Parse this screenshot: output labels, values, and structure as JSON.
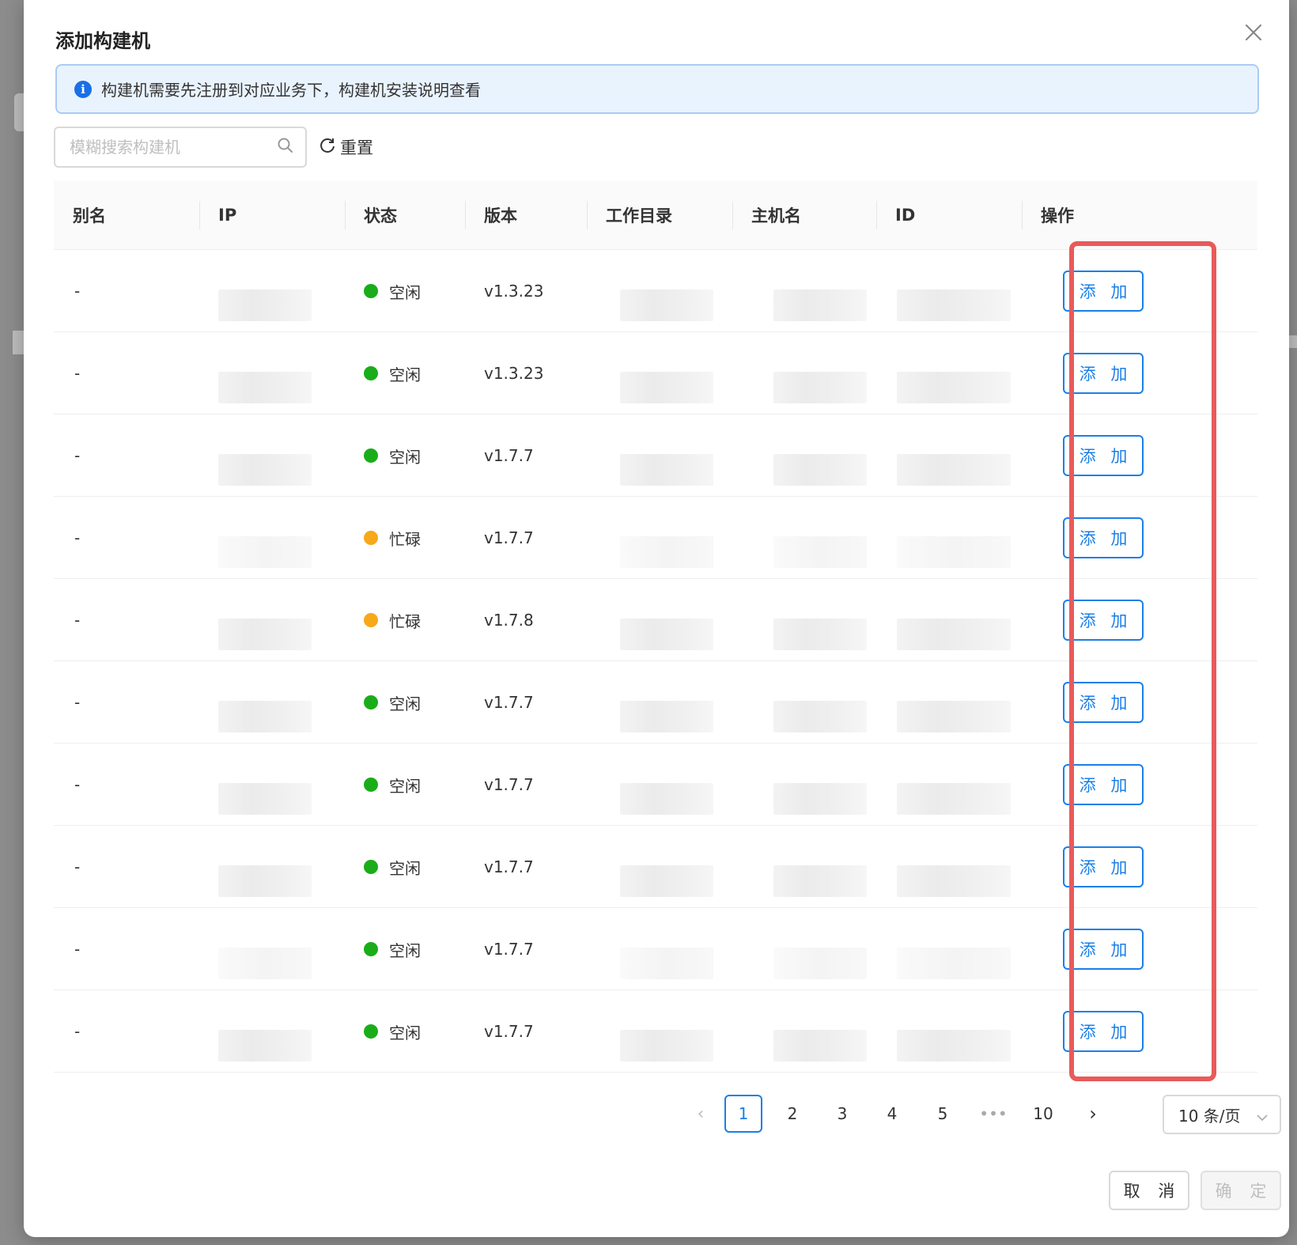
{
  "dialog": {
    "title": "添加构建机",
    "info": "构建机需要先注册到对应业务下，构建机安装说明查看"
  },
  "search": {
    "placeholder": "模糊搜索构建机",
    "reset_label": "重置"
  },
  "table": {
    "columns": [
      "别名",
      "IP",
      "状态",
      "版本",
      "工作目录",
      "主机名",
      "ID",
      "操作"
    ],
    "rows": [
      {
        "alias": "-",
        "status": "空闲",
        "status_color": "#1aad19",
        "version": "v1.3.23",
        "action": "添 加"
      },
      {
        "alias": "-",
        "status": "空闲",
        "status_color": "#1aad19",
        "version": "v1.3.23",
        "action": "添 加"
      },
      {
        "alias": "-",
        "status": "空闲",
        "status_color": "#1aad19",
        "version": "v1.7.7",
        "action": "添 加"
      },
      {
        "alias": "-",
        "status": "忙碌",
        "status_color": "#f7a81b",
        "version": "v1.7.7",
        "action": "添 加"
      },
      {
        "alias": "-",
        "status": "忙碌",
        "status_color": "#f7a81b",
        "version": "v1.7.8",
        "action": "添 加"
      },
      {
        "alias": "-",
        "status": "空闲",
        "status_color": "#1aad19",
        "version": "v1.7.7",
        "action": "添 加"
      },
      {
        "alias": "-",
        "status": "空闲",
        "status_color": "#1aad19",
        "version": "v1.7.7",
        "action": "添 加"
      },
      {
        "alias": "-",
        "status": "空闲",
        "status_color": "#1aad19",
        "version": "v1.7.7",
        "action": "添 加"
      },
      {
        "alias": "-",
        "status": "空闲",
        "status_color": "#1aad19",
        "version": "v1.7.7",
        "action": "添 加"
      },
      {
        "alias": "-",
        "status": "空闲",
        "status_color": "#1aad19",
        "version": "v1.7.7",
        "action": "添 加"
      }
    ]
  },
  "pagination": {
    "pages": [
      "1",
      "2",
      "3",
      "4",
      "5",
      "•••",
      "10"
    ],
    "current": "1",
    "page_size": "10 条/页"
  },
  "footer": {
    "cancel": "取 消",
    "confirm": "确 定"
  },
  "colors": {
    "accent": "#1a7fe8",
    "highlight": "#e85a5a",
    "idle": "#1aad19",
    "busy": "#f7a81b"
  }
}
